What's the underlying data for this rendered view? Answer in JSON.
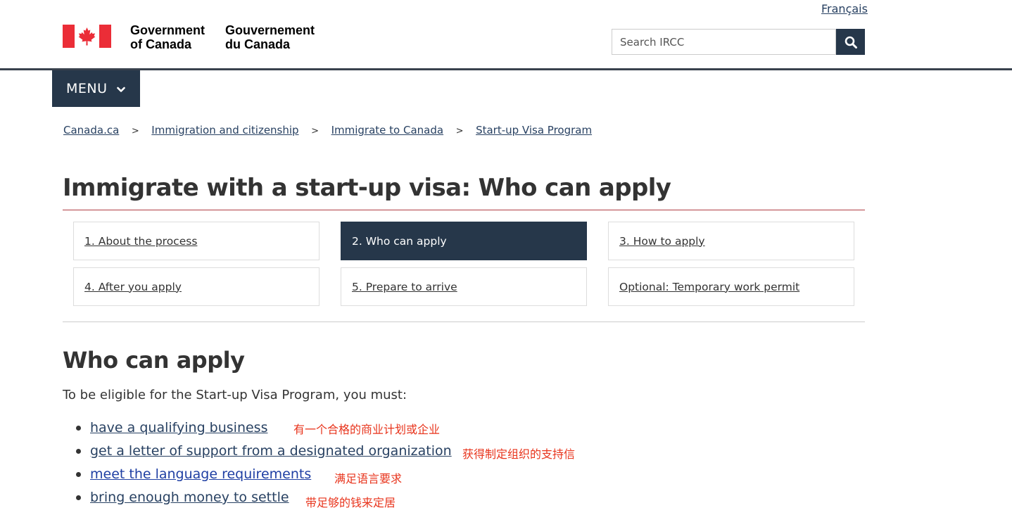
{
  "header": {
    "language_link": "Français",
    "wordmark_en": "Government\nof Canada",
    "wordmark_fr": "Gouvernement\ndu Canada",
    "search_placeholder": "Search IRCC",
    "menu_label": "MENU"
  },
  "breadcrumb": [
    "Canada.ca",
    "Immigration and citizenship",
    "Immigrate to Canada",
    "Start-up Visa Program"
  ],
  "page_title": "Immigrate with a start-up visa: Who can apply",
  "steps": [
    {
      "label": "1. About the process",
      "active": false
    },
    {
      "label": "2. Who can apply",
      "active": true
    },
    {
      "label": "3. How to apply",
      "active": false
    },
    {
      "label": "4. After you apply",
      "active": false
    },
    {
      "label": "5. Prepare to arrive",
      "active": false
    },
    {
      "label": "Optional: Temporary work permit",
      "active": false
    }
  ],
  "content": {
    "heading": "Who can apply",
    "intro": "To be eligible for the Start-up Visa Program, you must:",
    "requirements": [
      {
        "label": "have a qualifying business",
        "note": "有一个合格的商业计划或企业"
      },
      {
        "label": "get a letter of support from a designated organization",
        "note": "获得制定组织的支持信"
      },
      {
        "label": "meet the language requirements",
        "note": "满足语言要求"
      },
      {
        "label": "bring enough money to settle",
        "note": "带足够的钱来定居"
      }
    ]
  },
  "colors": {
    "brand_navy": "#26374a",
    "flag_red": "#eb2d37",
    "link": "#284162",
    "title_rule": "#af3c43",
    "annotation_red": "#e8341c"
  },
  "icons": {
    "flag": "canada-flag-icon",
    "search": "search-icon",
    "menu_chevron": "chevron-down-icon"
  }
}
